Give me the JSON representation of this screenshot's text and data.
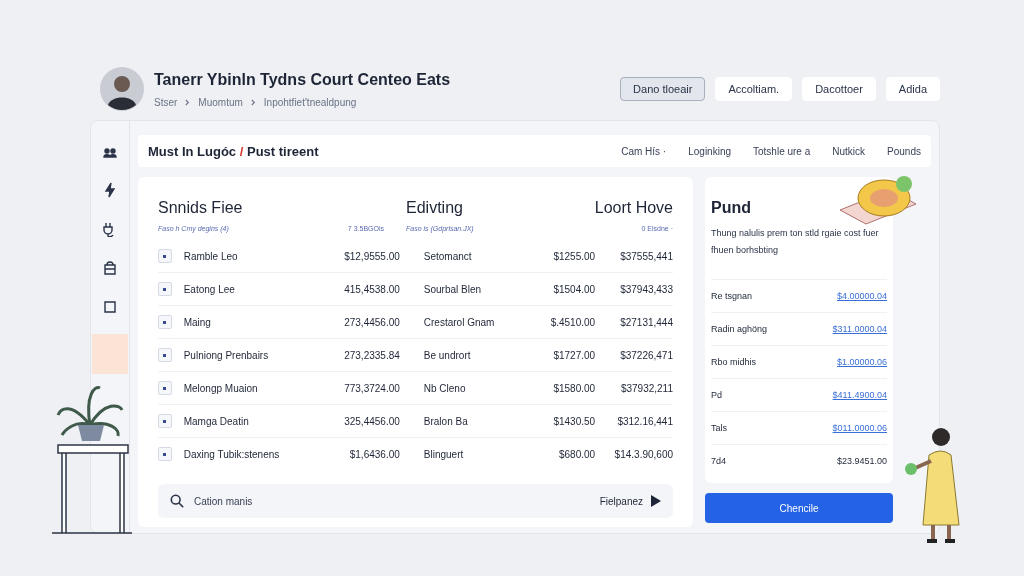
{
  "header": {
    "title": "Tanerr Ybinln Tydns Court Centeo Eats",
    "breadcrumb": [
      "Stser",
      "Muomtum",
      "Inpohtfiet'tnealdpung"
    ]
  },
  "actions": [
    {
      "label": "Dano tloeair",
      "selected": true
    },
    {
      "label": "Accoltiam.",
      "selected": false
    },
    {
      "label": "Dacottoer",
      "selected": false
    },
    {
      "label": "Adida",
      "selected": false
    }
  ],
  "sidebar": {
    "items": [
      {
        "kind": "people",
        "selected": false
      },
      {
        "kind": "bolt",
        "selected": false
      },
      {
        "kind": "plug",
        "selected": false
      },
      {
        "kind": "bag",
        "selected": false
      },
      {
        "kind": "card",
        "selected": false
      },
      {
        "kind": "blank",
        "selected": true
      }
    ]
  },
  "tabbar": {
    "title_before": "Must In Lugóc",
    "title_mark": "/",
    "title_after": "Pust tireent",
    "links": [
      "Cam Hís ·",
      "Loginking",
      "Totshle ure a",
      "Nutkick",
      "Pounds"
    ]
  },
  "table": {
    "groups": [
      {
        "title": "Snnids Fiee",
        "subtitle": "Faso h Cmy degins (4)",
        "note": "7 3.5BGOis"
      },
      {
        "title": "Edivting",
        "subtitle": "Faso is (Gdprlsan.JX)"
      },
      {
        "title": "Loort Hove",
        "note": "0 Elsdne ·"
      }
    ],
    "rows": [
      {
        "name": "Ramble Leo",
        "amount": "$12,9555.00",
        "item": "Setomanct",
        "price": "$1255.00",
        "total": "$37555,441"
      },
      {
        "name": "Eatong Lee",
        "amount": "415,4538.00",
        "item": "Sourbal Blen",
        "price": "$1504.00",
        "total": "$37943,433"
      },
      {
        "name": "Maing",
        "amount": "273,4456.00",
        "item": "Crestarol Gnam",
        "price": "$.4510.00",
        "total": "$27131,444"
      },
      {
        "name": "Pulniong Prenbairs",
        "amount": "273,2335.84",
        "item": "Be undrort",
        "price": "$1727.00",
        "total": "$37226,471"
      },
      {
        "name": "Melongp Muaion",
        "amount": "773,3724.00",
        "item": "Nb Cleno",
        "price": "$1580.00",
        "total": "$37932,211"
      },
      {
        "name": "Mamga Deatin",
        "amount": "325,4456.00",
        "item": "Bralon Ba",
        "price": "$1430.50",
        "total": "$312.16,441"
      },
      {
        "name": "Daxing Tubik:stenens",
        "amount": "$1,6436.00",
        "item": "Blinguert",
        "price": "$680.00",
        "total": "$14.3.90,600"
      }
    ]
  },
  "search": {
    "placeholder": "Cation manis",
    "action": "Fielpanez"
  },
  "summary": {
    "title": "Pund",
    "description": "Thung nalulis prem ton stld rgaie cost fuer fhuen borhsbting",
    "items": [
      {
        "label": "Re tsgnan",
        "value": "$4.00000.04",
        "kind": "link"
      },
      {
        "label": "Radin aghöng",
        "value": "$311.0000.04",
        "kind": "link"
      },
      {
        "label": "Rbo midhis",
        "value": "$1.00000.06",
        "kind": "link"
      },
      {
        "label": "Pd",
        "value": "$411.4900.04",
        "kind": "link"
      },
      {
        "label": "Tals",
        "value": "$011.0000.06",
        "kind": "link"
      },
      {
        "label": "7d4",
        "value": "$23.9451.00",
        "kind": "total"
      }
    ],
    "button": "Chencile"
  }
}
